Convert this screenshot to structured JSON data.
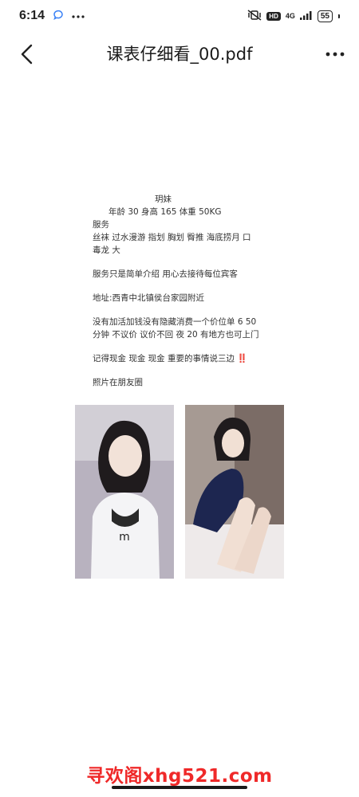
{
  "status_bar": {
    "time": "6:14",
    "hd": "HD",
    "network": "4G",
    "battery": "55"
  },
  "app_bar": {
    "title": "课表仔细看_00.pdf"
  },
  "document": {
    "lines": [
      "玥妹",
      "年龄 30 身高 165 体重 50KG",
      "服务",
      "丝袜 过水漫游 指划 胸划 臀推 海底捞月 口",
      "毒龙 大",
      "服务只是简单介绍 用心去接待每位宾客",
      "地址:西青中北镇侯台家园附近",
      "没有加活加钱没有隐藏消费一个价位单 6 50",
      "分钟 不议价 议价不回 夜 20  有地方也可上门",
      "记得现金 现金 现金 重要的事情说三边",
      "‼️",
      "照片在朋友圈"
    ]
  },
  "watermark": "寻欢阁xhg521.com",
  "colors": {
    "accent_red": "#ef2929",
    "text": "#333333"
  }
}
